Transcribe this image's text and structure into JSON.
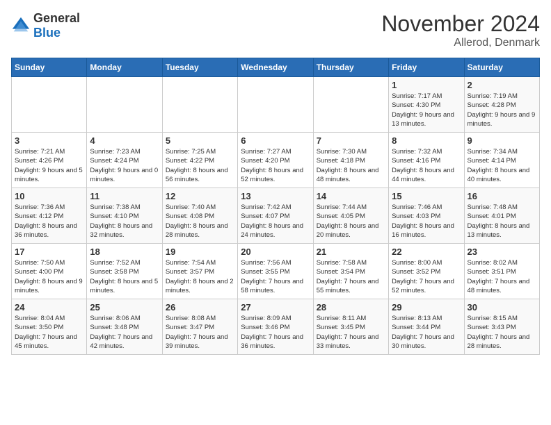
{
  "logo": {
    "general": "General",
    "blue": "Blue"
  },
  "title": "November 2024",
  "subtitle": "Allerod, Denmark",
  "weekdays": [
    "Sunday",
    "Monday",
    "Tuesday",
    "Wednesday",
    "Thursday",
    "Friday",
    "Saturday"
  ],
  "weeks": [
    [
      {
        "day": "",
        "sunrise": "",
        "sunset": "",
        "daylight": ""
      },
      {
        "day": "",
        "sunrise": "",
        "sunset": "",
        "daylight": ""
      },
      {
        "day": "",
        "sunrise": "",
        "sunset": "",
        "daylight": ""
      },
      {
        "day": "",
        "sunrise": "",
        "sunset": "",
        "daylight": ""
      },
      {
        "day": "",
        "sunrise": "",
        "sunset": "",
        "daylight": ""
      },
      {
        "day": "1",
        "sunrise": "Sunrise: 7:17 AM",
        "sunset": "Sunset: 4:30 PM",
        "daylight": "Daylight: 9 hours and 13 minutes."
      },
      {
        "day": "2",
        "sunrise": "Sunrise: 7:19 AM",
        "sunset": "Sunset: 4:28 PM",
        "daylight": "Daylight: 9 hours and 9 minutes."
      }
    ],
    [
      {
        "day": "3",
        "sunrise": "Sunrise: 7:21 AM",
        "sunset": "Sunset: 4:26 PM",
        "daylight": "Daylight: 9 hours and 5 minutes."
      },
      {
        "day": "4",
        "sunrise": "Sunrise: 7:23 AM",
        "sunset": "Sunset: 4:24 PM",
        "daylight": "Daylight: 9 hours and 0 minutes."
      },
      {
        "day": "5",
        "sunrise": "Sunrise: 7:25 AM",
        "sunset": "Sunset: 4:22 PM",
        "daylight": "Daylight: 8 hours and 56 minutes."
      },
      {
        "day": "6",
        "sunrise": "Sunrise: 7:27 AM",
        "sunset": "Sunset: 4:20 PM",
        "daylight": "Daylight: 8 hours and 52 minutes."
      },
      {
        "day": "7",
        "sunrise": "Sunrise: 7:30 AM",
        "sunset": "Sunset: 4:18 PM",
        "daylight": "Daylight: 8 hours and 48 minutes."
      },
      {
        "day": "8",
        "sunrise": "Sunrise: 7:32 AM",
        "sunset": "Sunset: 4:16 PM",
        "daylight": "Daylight: 8 hours and 44 minutes."
      },
      {
        "day": "9",
        "sunrise": "Sunrise: 7:34 AM",
        "sunset": "Sunset: 4:14 PM",
        "daylight": "Daylight: 8 hours and 40 minutes."
      }
    ],
    [
      {
        "day": "10",
        "sunrise": "Sunrise: 7:36 AM",
        "sunset": "Sunset: 4:12 PM",
        "daylight": "Daylight: 8 hours and 36 minutes."
      },
      {
        "day": "11",
        "sunrise": "Sunrise: 7:38 AM",
        "sunset": "Sunset: 4:10 PM",
        "daylight": "Daylight: 8 hours and 32 minutes."
      },
      {
        "day": "12",
        "sunrise": "Sunrise: 7:40 AM",
        "sunset": "Sunset: 4:08 PM",
        "daylight": "Daylight: 8 hours and 28 minutes."
      },
      {
        "day": "13",
        "sunrise": "Sunrise: 7:42 AM",
        "sunset": "Sunset: 4:07 PM",
        "daylight": "Daylight: 8 hours and 24 minutes."
      },
      {
        "day": "14",
        "sunrise": "Sunrise: 7:44 AM",
        "sunset": "Sunset: 4:05 PM",
        "daylight": "Daylight: 8 hours and 20 minutes."
      },
      {
        "day": "15",
        "sunrise": "Sunrise: 7:46 AM",
        "sunset": "Sunset: 4:03 PM",
        "daylight": "Daylight: 8 hours and 16 minutes."
      },
      {
        "day": "16",
        "sunrise": "Sunrise: 7:48 AM",
        "sunset": "Sunset: 4:01 PM",
        "daylight": "Daylight: 8 hours and 13 minutes."
      }
    ],
    [
      {
        "day": "17",
        "sunrise": "Sunrise: 7:50 AM",
        "sunset": "Sunset: 4:00 PM",
        "daylight": "Daylight: 8 hours and 9 minutes."
      },
      {
        "day": "18",
        "sunrise": "Sunrise: 7:52 AM",
        "sunset": "Sunset: 3:58 PM",
        "daylight": "Daylight: 8 hours and 5 minutes."
      },
      {
        "day": "19",
        "sunrise": "Sunrise: 7:54 AM",
        "sunset": "Sunset: 3:57 PM",
        "daylight": "Daylight: 8 hours and 2 minutes."
      },
      {
        "day": "20",
        "sunrise": "Sunrise: 7:56 AM",
        "sunset": "Sunset: 3:55 PM",
        "daylight": "Daylight: 7 hours and 58 minutes."
      },
      {
        "day": "21",
        "sunrise": "Sunrise: 7:58 AM",
        "sunset": "Sunset: 3:54 PM",
        "daylight": "Daylight: 7 hours and 55 minutes."
      },
      {
        "day": "22",
        "sunrise": "Sunrise: 8:00 AM",
        "sunset": "Sunset: 3:52 PM",
        "daylight": "Daylight: 7 hours and 52 minutes."
      },
      {
        "day": "23",
        "sunrise": "Sunrise: 8:02 AM",
        "sunset": "Sunset: 3:51 PM",
        "daylight": "Daylight: 7 hours and 48 minutes."
      }
    ],
    [
      {
        "day": "24",
        "sunrise": "Sunrise: 8:04 AM",
        "sunset": "Sunset: 3:50 PM",
        "daylight": "Daylight: 7 hours and 45 minutes."
      },
      {
        "day": "25",
        "sunrise": "Sunrise: 8:06 AM",
        "sunset": "Sunset: 3:48 PM",
        "daylight": "Daylight: 7 hours and 42 minutes."
      },
      {
        "day": "26",
        "sunrise": "Sunrise: 8:08 AM",
        "sunset": "Sunset: 3:47 PM",
        "daylight": "Daylight: 7 hours and 39 minutes."
      },
      {
        "day": "27",
        "sunrise": "Sunrise: 8:09 AM",
        "sunset": "Sunset: 3:46 PM",
        "daylight": "Daylight: 7 hours and 36 minutes."
      },
      {
        "day": "28",
        "sunrise": "Sunrise: 8:11 AM",
        "sunset": "Sunset: 3:45 PM",
        "daylight": "Daylight: 7 hours and 33 minutes."
      },
      {
        "day": "29",
        "sunrise": "Sunrise: 8:13 AM",
        "sunset": "Sunset: 3:44 PM",
        "daylight": "Daylight: 7 hours and 30 minutes."
      },
      {
        "day": "30",
        "sunrise": "Sunrise: 8:15 AM",
        "sunset": "Sunset: 3:43 PM",
        "daylight": "Daylight: 7 hours and 28 minutes."
      }
    ]
  ]
}
